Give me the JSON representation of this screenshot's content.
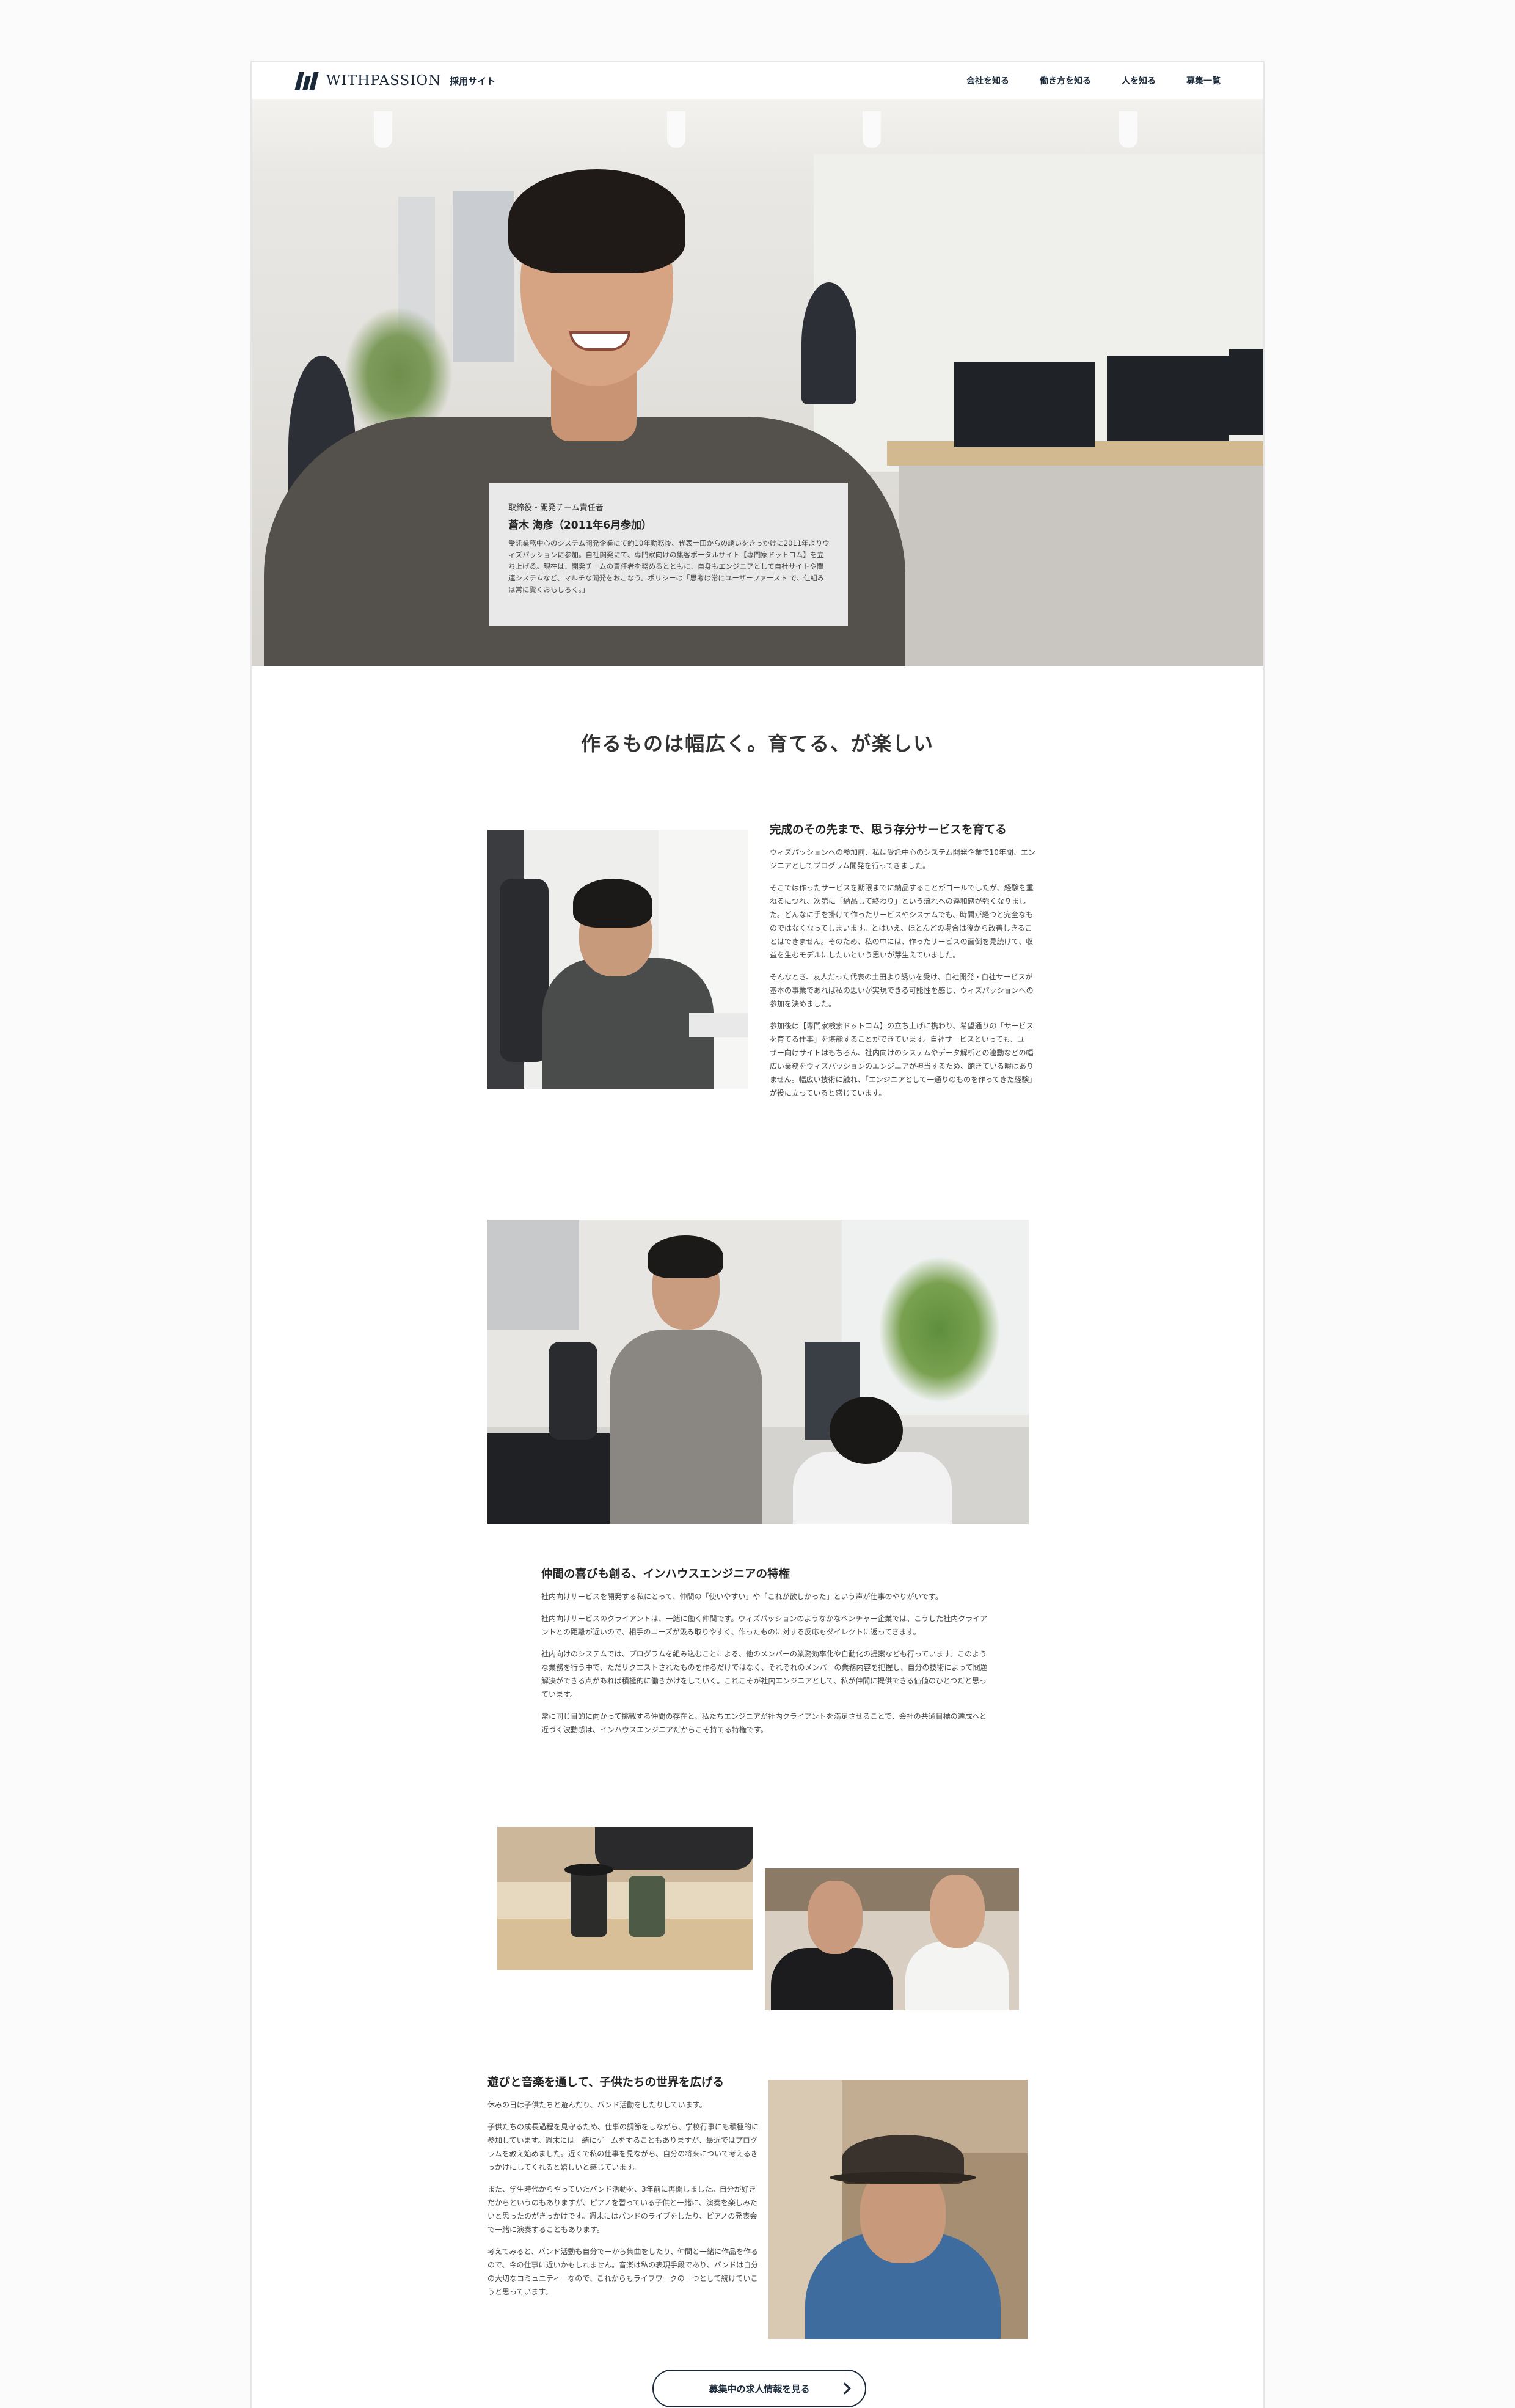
{
  "header": {
    "logo_text": "WITHPASSION",
    "logo_sub": "採用サイト",
    "nav": [
      "会社を知る",
      "働き方を知る",
      "人を知る",
      "募集一覧"
    ]
  },
  "hero": {
    "role": "取締役・開発チーム責任者",
    "name": "蒼木 海彦（2011年6月参加）",
    "bio": "受託業務中心のシステム開発企業にて約10年勤務後、代表土田からの誘いをきっかけに2011年よりウィズパッションに参加。自社開発にて、専門家向けの集客ポータルサイト【専門家ドットコム】を立ち上げる。現在は、開発チームの責任者を務めるとともに、自身もエンジニアとして自社サイトや関連システムなど、マルチな開発をおこなう。ポリシーは「思考は常にユーザーファースト で、仕組みは常に賢くおもしろく。」"
  },
  "headline": "作るものは幅広く。育てる、が楽しい",
  "section1": {
    "title": "完成のその先まで、思う存分サービスを育てる",
    "paragraphs": [
      "ウィズパッションへの参加前、私は受託中心のシステム開発企業で10年間、エンジニアとしてプログラム開発を行ってきました。",
      "そこでは作ったサービスを期限までに納品することがゴールでしたが、経験を重ねるにつれ、次第に「納品して終わり」という流れへの違和感が強くなりました。どんなに手を掛けて作ったサービスやシステムでも、時間が経つと完全なものではなくなってしまいます。とはいえ、ほとんどの場合は後から改善しきることはできません。そのため、私の中には、作ったサービスの面倒を見続けて、収益を生むモデルにしたいという思いが芽生えていました。",
      "そんなとき、友人だった代表の土田より誘いを受け、自社開発・自社サービスが基本の事業であれば私の思いが実現できる可能性を感じ、ウィズパッションへの参加を決めました。",
      "参加後は【専門家検索ドットコム】の立ち上げに携わり、希望通りの「サービスを育てる仕事」を堪能することができています。自社サービスといっても、ユーザー向けサイトはもちろん、社内向けのシステムやデータ解析との連動などの幅広い業務をウィズパッションのエンジニアが担当するため、飽きている暇はありません。幅広い技術に触れ、「エンジニアとして一通りのものを作ってきた経験」が役に立っていると感じています。"
    ]
  },
  "section2": {
    "title": "仲間の喜びも創る、インハウスエンジニアの特権",
    "paragraphs": [
      "社内向けサービスを開発する私にとって、仲間の「使いやすい」や「これが欲しかった」という声が仕事のやりがいです。",
      "社内向けサービスのクライアントは、一緒に働く仲間です。ウィズパッションのようなかなベンチャー企業では、こうした社内クライアントとの距離が近いので、相手のニーズが汲み取りやすく、作ったものに対する反応もダイレクトに返ってきます。",
      "社内向けのシステムでは、プログラムを組み込むことによる、他のメンバーの業務効率化や自動化の提案なども行っています。このような業務を行う中で、ただリクエストされたものを作るだけではなく、それぞれのメンバーの業務内容を把握し、自分の技術によって問題解決ができる点があれば積極的に働きかけをしていく。これこそが社内エンジニアとして、私が仲間に提供できる価値のひとつだと思っています。",
      "常に同じ目的に向かって挑戦する仲間の存在と、私たちエンジニアが社内クライアントを満足させることで、会社の共通目標の達成へと近づく波動感は、インハウスエンジニアだからこそ持てる特権です。"
    ]
  },
  "section3": {
    "title": "遊びと音楽を通して、子供たちの世界を広げる",
    "paragraphs": [
      "休みの日は子供たちと遊んだり、バンド活動をしたりしています。",
      "子供たちの成長過程を見守るため、仕事の調節をしながら、学校行事にも積極的に参加しています。週末には一緒にゲームをすることもありますが、最近ではプログラムを教え始めました。近くで私の仕事を見ながら、自分の将来について考えるきっかけにしてくれると嬉しいと感じています。",
      "また、学生時代からやっていたバンド活動を、3年前に再開しました。自分が好きだからというのもありますが、ピアノを習っている子供と一緒に、演奏を楽しみたいと思ったのがきっかけです。週末にはバンドのライブをしたり、ピアノの発表会で一緒に演奏することもあります。",
      "考えてみると、バンド活動も自分で一から集曲をしたり、仲間と一緒に作品を作るので、今の仕事に近いかもしれません。音楽は私の表現手段であり、バンドは自分の大切なコミュニティーなので、これからもライフワークの一つとして続けていこうと思っています。"
    ]
  },
  "cta_label": "募集中の求人情報を見る"
}
